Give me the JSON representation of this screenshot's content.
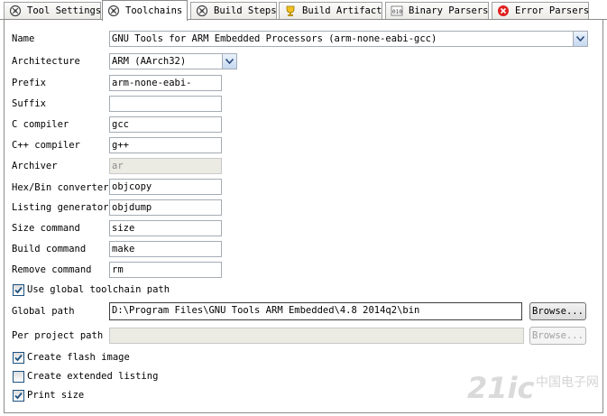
{
  "tabs": [
    {
      "label": "Tool Settings",
      "icon": "tool-settings-icon"
    },
    {
      "label": "Toolchains",
      "icon": "toolchains-icon",
      "active": true
    },
    {
      "label": "Build Steps",
      "icon": "build-steps-icon"
    },
    {
      "label": "Build Artifact",
      "icon": "build-artifact-icon"
    },
    {
      "label": "Binary Parsers",
      "icon": "binary-parsers-icon"
    },
    {
      "label": "Error Parsers",
      "icon": "error-parsers-icon"
    }
  ],
  "form": {
    "name_label": "Name",
    "name_value": "GNU Tools for ARM Embedded Processors (arm-none-eabi-gcc)",
    "architecture_label": "Architecture",
    "architecture_value": "ARM (AArch32)",
    "prefix_label": "Prefix",
    "prefix_value": "arm-none-eabi-",
    "suffix_label": "Suffix",
    "suffix_value": "",
    "c_compiler_label": "C compiler",
    "c_compiler_value": "gcc",
    "cpp_compiler_label": "C++ compiler",
    "cpp_compiler_value": "g++",
    "archiver_label": "Archiver",
    "archiver_value": "ar",
    "hexbin_label": "Hex/Bin converter",
    "hexbin_value": "objcopy",
    "listing_label": "Listing generator",
    "listing_value": "objdump",
    "size_label": "Size command",
    "size_value": "size",
    "build_label": "Build command",
    "build_value": "make",
    "remove_label": "Remove command",
    "remove_value": "rm",
    "use_global_label": "Use global toolchain path",
    "use_global_checked": true,
    "global_path_label": "Global path",
    "global_path_value": "D:\\Program Files\\GNU Tools ARM Embedded\\4.8 2014q2\\bin",
    "browse_label": "Browse...",
    "per_project_label": "Per project path",
    "per_project_value": "",
    "browse2_label": "Browse...",
    "flash_label": "Create flash image",
    "flash_checked": true,
    "extended_label": "Create extended listing",
    "extended_checked": false,
    "print_size_label": "Print size",
    "print_size_checked": true
  },
  "watermark": {
    "text": "21ic",
    "cn": "中国电子网"
  }
}
